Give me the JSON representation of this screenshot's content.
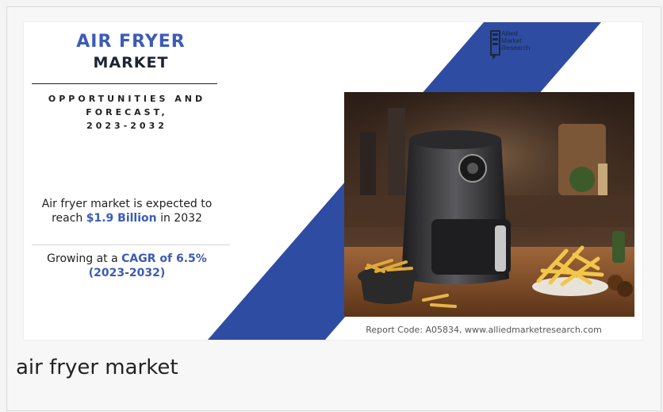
{
  "infographic": {
    "title_line1": "AIR FRYER",
    "title_line2": "MARKET",
    "subtitle_lines": [
      "OPPORTUNITIES AND",
      "FORECAST,",
      "2023-2032"
    ],
    "stat1": {
      "pre": "Air fryer market is expected to reach ",
      "value": "$1.9 Billion",
      "post": " in 2032"
    },
    "stat2": {
      "pre": "Growing at a ",
      "value": "CAGR of 6.5% (2023-2032)"
    },
    "logo": {
      "lines": [
        "Allied",
        "Market",
        "Research"
      ],
      "icon": "allied-market-research-logo-icon"
    },
    "photo_alt": "air-fryer-photo",
    "footer": "Report Code: A05834, www.alliedmarketresearch.com",
    "colors": {
      "accent_blue": "#3b5bb7",
      "band_blue": "#2f4ca3",
      "dark_text": "#1d2433"
    }
  },
  "caption": "air fryer market"
}
